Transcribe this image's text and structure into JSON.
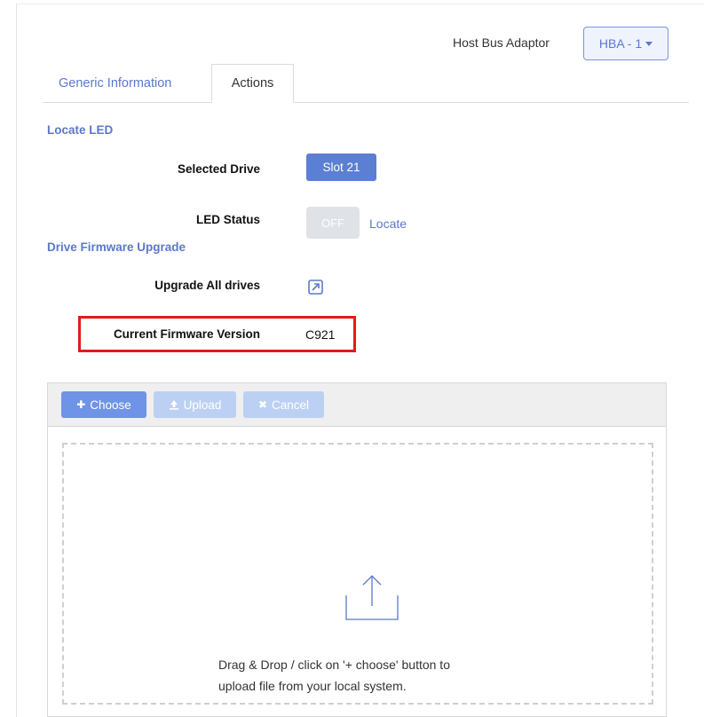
{
  "header": {
    "hba_label": "Host Bus Adaptor",
    "hba_value": "HBA - 1"
  },
  "tabs": [
    {
      "label": "Generic Information"
    },
    {
      "label": "Actions"
    }
  ],
  "locate_led": {
    "section_title": "Locate LED",
    "selected_drive_label": "Selected Drive",
    "selected_drive_value": "Slot 21",
    "led_status_label": "LED Status",
    "led_status_value": "OFF",
    "locate_link": "Locate"
  },
  "firmware": {
    "section_title": "Drive Firmware Upgrade",
    "upgrade_all_label": "Upgrade All drives",
    "current_version_label": "Current Firmware Version",
    "current_version_value": "C921"
  },
  "uploader": {
    "choose_label": "Choose",
    "upload_label": "Upload",
    "cancel_label": "Cancel",
    "drop_text_line1": "Drag & Drop / click on '+ choose' button to",
    "drop_text_line2": "upload file from your local system."
  },
  "colors": {
    "accent": "#5b79c9",
    "highlight": "#e31a1a",
    "button_primary": "#5b7fd2"
  }
}
